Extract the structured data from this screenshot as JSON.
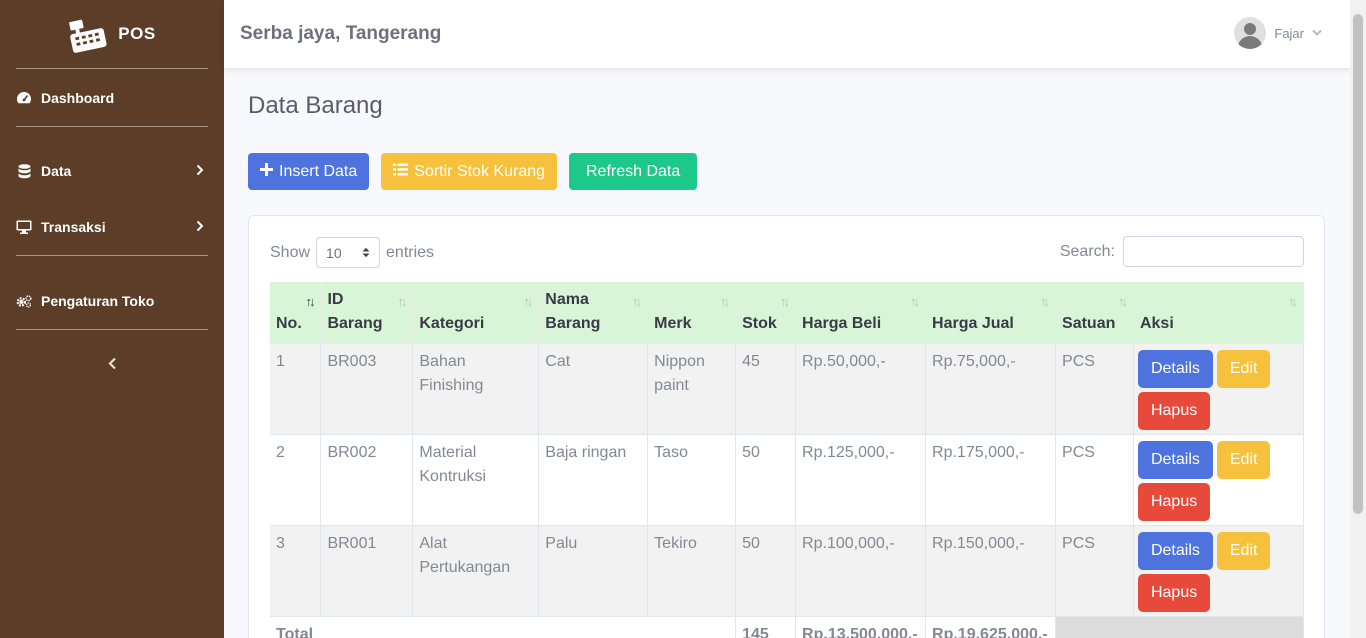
{
  "brand": {
    "name": "POS"
  },
  "sidebar": {
    "items": [
      {
        "label": "Dashboard",
        "icon": "tachometer-icon"
      },
      {
        "label": "Data",
        "icon": "database-icon"
      },
      {
        "label": "Transaksi",
        "icon": "desktop-icon"
      },
      {
        "label": "Pengaturan Toko",
        "icon": "cogs-icon"
      }
    ]
  },
  "topbar": {
    "store": "Serba jaya, Tangerang",
    "user": "Fajar"
  },
  "page": {
    "title": "Data Barang"
  },
  "actions": {
    "insert": "Insert Data",
    "sort": "Sortir Stok Kurang",
    "refresh": "Refresh Data"
  },
  "table_controls": {
    "show": "Show",
    "entries_value": "10",
    "entries": "entries",
    "search": "Search:"
  },
  "table": {
    "headers": [
      {
        "line1": "",
        "line2": "No."
      },
      {
        "line1": "ID",
        "line2": "Barang"
      },
      {
        "line1": "",
        "line2": "Kategori"
      },
      {
        "line1": "Nama",
        "line2": "Barang"
      },
      {
        "line1": "",
        "line2": "Merk"
      },
      {
        "line1": "",
        "line2": "Stok"
      },
      {
        "line1": "",
        "line2": "Harga Beli"
      },
      {
        "line1": "",
        "line2": "Harga Jual"
      },
      {
        "line1": "",
        "line2": "Satuan"
      },
      {
        "line1": "",
        "line2": "Aksi"
      }
    ],
    "rows": [
      [
        "1",
        "BR003",
        "Bahan Finishing",
        "Cat",
        "Nippon paint",
        "45",
        "Rp.50,000,-",
        "Rp.75,000,-",
        "PCS"
      ],
      [
        "2",
        "BR002",
        "Material Kontruksi",
        "Baja ringan",
        "Taso",
        "50",
        "Rp.125,000,-",
        "Rp.175,000,-",
        "PCS"
      ],
      [
        "3",
        "BR001",
        "Alat Pertukangan",
        "Palu",
        "Tekiro",
        "50",
        "Rp.100,000,-",
        "Rp.150,000,-",
        "PCS"
      ]
    ],
    "row_actions": {
      "details": "Details",
      "edit": "Edit",
      "hapus": "Hapus"
    },
    "total": {
      "label": "Total",
      "stok": "145",
      "beli": "Rp.13,500,000,-",
      "jual": "Rp.19,625,000,-"
    }
  },
  "colors": {
    "sidebar": "#5c3d27",
    "primary": "#4e73df",
    "warning": "#f6c23e",
    "success": "#1cc88a",
    "danger": "#e74a3b",
    "table_header": "#d8f5d8"
  }
}
